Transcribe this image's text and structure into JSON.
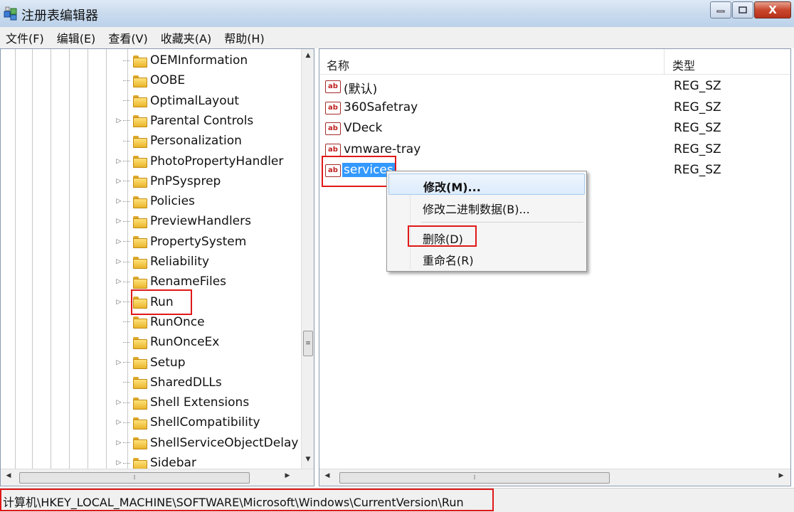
{
  "window": {
    "title": "注册表编辑器",
    "icon": "regedit-icon"
  },
  "title_buttons": {
    "minimize_icon": "minimize-icon",
    "maximize_icon": "maximize-icon",
    "close_label": "X"
  },
  "menubar": {
    "file": "文件(F)",
    "edit": "编辑(E)",
    "view": "查看(V)",
    "favorites": "收藏夹(A)",
    "help": "帮助(H)"
  },
  "tree": {
    "items": [
      {
        "label": "OEMInformation"
      },
      {
        "label": "OOBE"
      },
      {
        "label": "OptimalLayout"
      },
      {
        "label": "Parental Controls"
      },
      {
        "label": "Personalization"
      },
      {
        "label": "PhotoPropertyHandler"
      },
      {
        "label": "PnPSysprep"
      },
      {
        "label": "Policies"
      },
      {
        "label": "PreviewHandlers"
      },
      {
        "label": "PropertySystem"
      },
      {
        "label": "Reliability"
      },
      {
        "label": "RenameFiles"
      },
      {
        "label": "Run"
      },
      {
        "label": "RunOnce"
      },
      {
        "label": "RunOnceEx"
      },
      {
        "label": "Setup"
      },
      {
        "label": "SharedDLLs"
      },
      {
        "label": "Shell Extensions"
      },
      {
        "label": "ShellCompatibility"
      },
      {
        "label": "ShellServiceObjectDelay"
      },
      {
        "label": "Sidebar"
      }
    ],
    "selected": "Run"
  },
  "values_list": {
    "columns": {
      "name": "名称",
      "type": "类型"
    },
    "rows": [
      {
        "name": "(默认)",
        "type": "REG_SZ"
      },
      {
        "name": "360Safetray",
        "type": "REG_SZ"
      },
      {
        "name": "VDeck",
        "type": "REG_SZ"
      },
      {
        "name": "vmware-tray",
        "type": "REG_SZ"
      },
      {
        "name": "services",
        "type": "REG_SZ"
      }
    ],
    "selected": "services",
    "value_icon_text": "ab"
  },
  "context_menu": {
    "modify": "修改(M)...",
    "modify_binary": "修改二进制数据(B)...",
    "delete": "删除(D)",
    "rename": "重命名(R)"
  },
  "statusbar": {
    "path": "计算机\\HKEY_LOCAL_MACHINE\\SOFTWARE\\Microsoft\\Windows\\CurrentVersion\\Run"
  },
  "colors": {
    "highlight_box": "#e01818",
    "selection": "#3399ff"
  }
}
